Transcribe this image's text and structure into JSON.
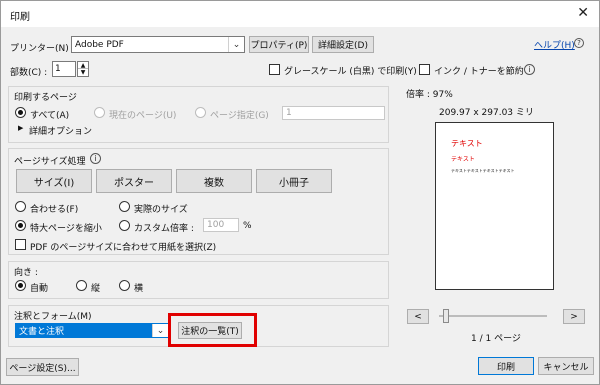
{
  "dialog": {
    "title": "印刷",
    "close": "✕"
  },
  "printer": {
    "label": "プリンター(N) :",
    "value": "Adobe PDF",
    "properties_button": "プロパティ(P)",
    "advanced_button": "詳細設定(D)",
    "help_link": "ヘルプ(H)",
    "help_icon_char": "?"
  },
  "copies": {
    "label": "部数(C) :",
    "value": "1",
    "grayscale_label": "グレースケール (白黒) で印刷(Y)",
    "save_ink_label": "インク / トナーを節約",
    "info_char": "i"
  },
  "pages": {
    "title": "印刷するページ",
    "all": "すべて(A)",
    "current": "現在のページ(U)",
    "specify": "ページ指定(G)",
    "range_value": "1",
    "more_options": "詳細オプション",
    "expand_char": "▶"
  },
  "sizing": {
    "title": "ページサイズ処理",
    "info_char": "i",
    "tab_size": "サイズ(I)",
    "tab_poster": "ポスター",
    "tab_multiple": "複数",
    "tab_booklet": "小冊子",
    "fit": "合わせる(F)",
    "actual": "実際のサイズ",
    "shrink": "特大ページを縮小",
    "custom": "カスタム倍率 :",
    "custom_value": "100",
    "percent": "%",
    "choose_paper": "PDF のページサイズに合わせて用紙を選択(Z)"
  },
  "orientation": {
    "title": "向き :",
    "auto": "自動",
    "portrait": "縦",
    "landscape": "横"
  },
  "comments": {
    "title": "注釈とフォーム(M)",
    "value": "文書と注釈",
    "summarize_button": "注釈の一覧(T)"
  },
  "preview": {
    "scale_label": "倍率 : 97%",
    "dimensions": "209.97 x 297.03 ミリ",
    "doc_title": "テキスト",
    "doc_sub": "テキスト",
    "doc_line": "テキストテキストテキストテキスト",
    "prev": "<",
    "next": ">",
    "page_counter": "1 / 1 ページ"
  },
  "footer": {
    "page_setup": "ページ設定(S)...",
    "print": "印刷",
    "cancel": "キャンセル"
  },
  "colors": {
    "highlight": "#e00000",
    "link": "#0645ad",
    "default_button_border": "#0078d7",
    "preview_text": "#e00000"
  }
}
